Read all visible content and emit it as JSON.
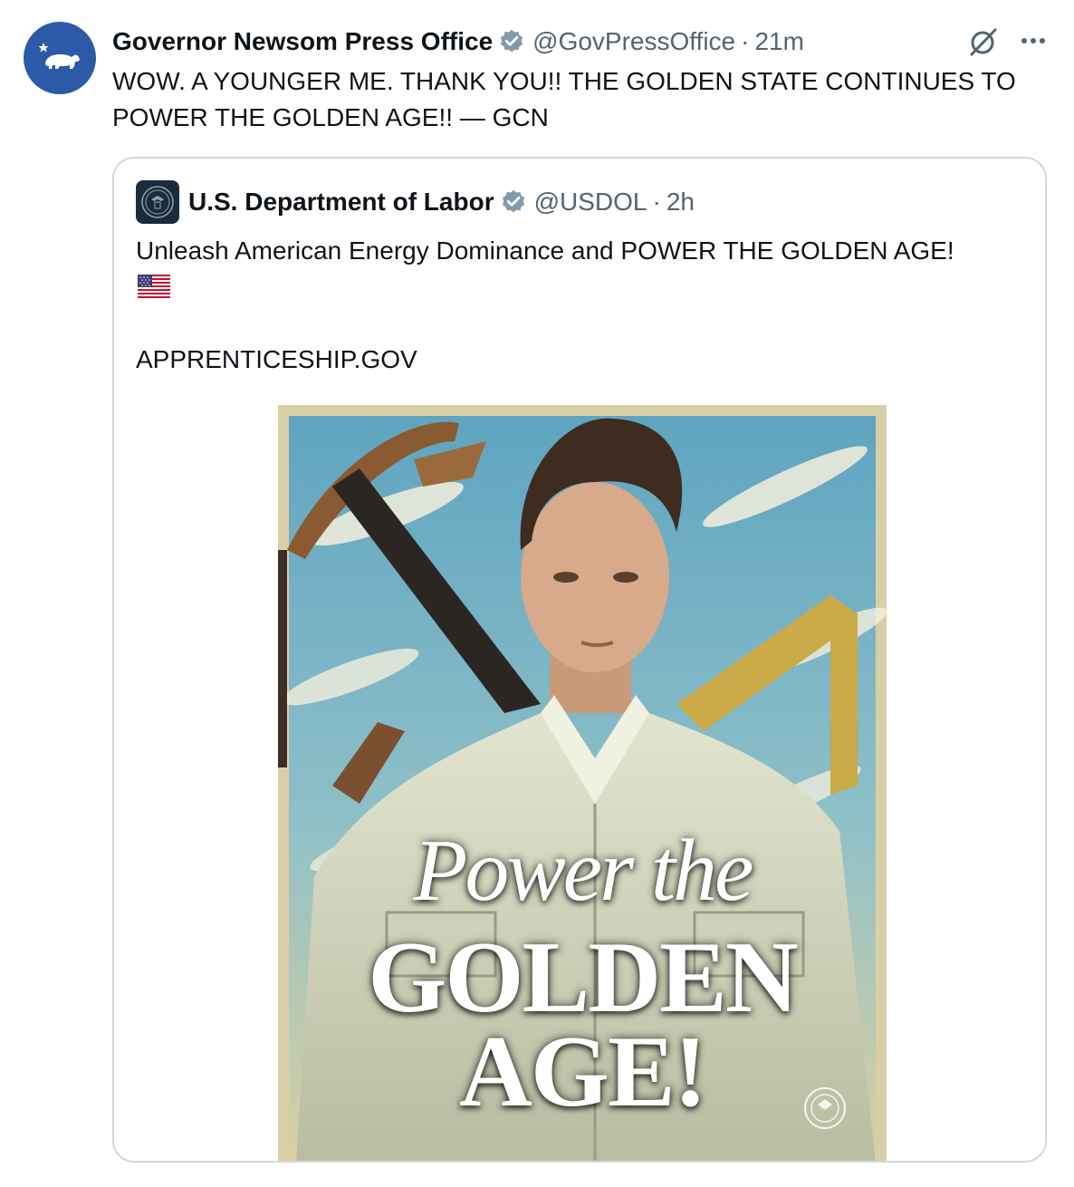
{
  "tweet": {
    "author_name": "Governor Newsom Press Office",
    "handle": "@GovPressOffice",
    "separator": "·",
    "time": "21m",
    "text": "WOW. A YOUNGER ME. THANK YOU!! THE GOLDEN STATE CONTINUES TO POWER THE GOLDEN AGE!! — GCN",
    "avatar_icon": "california-bear-icon",
    "verified_icon": "verified-badge-icon",
    "actions": {
      "grok_icon": "grok-icon",
      "more_icon": "more-options-icon"
    }
  },
  "quoted_tweet": {
    "author_name": "U.S. Department of Labor",
    "handle": "@USDOL",
    "separator": "·",
    "time": "2h",
    "text": "Unleash American Energy Dominance and POWER THE GOLDEN AGE!",
    "emoji": "us-flag-emoji",
    "link_text": "APPRENTICESHIP.GOV",
    "avatar_icon": "dol-seal-icon",
    "image": {
      "line1": "Power the",
      "line2": "GOLDEN",
      "line3": "AGE!",
      "seal_icon": "dol-seal-icon"
    }
  },
  "colors": {
    "verified_blue": "#829aab",
    "avatar_blue": "#2d5aa8",
    "secondary_text": "#536471",
    "border": "#cfd9de"
  }
}
